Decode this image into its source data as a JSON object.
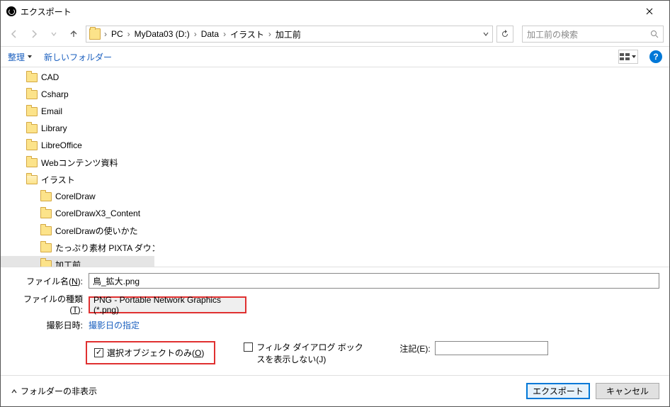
{
  "window": {
    "title": "エクスポート"
  },
  "breadcrumb": {
    "items": [
      "PC",
      "MyData03 (D:)",
      "Data",
      "イラスト",
      "加工前"
    ]
  },
  "search": {
    "placeholder": "加工前の検索"
  },
  "toolbar": {
    "organize": "整理",
    "newfolder": "新しいフォルダー"
  },
  "help": {
    "label": "?"
  },
  "tree": {
    "items": [
      {
        "label": "CAD",
        "depth": 1
      },
      {
        "label": "Csharp",
        "depth": 1
      },
      {
        "label": "Email",
        "depth": 1
      },
      {
        "label": "Library",
        "depth": 1
      },
      {
        "label": "LibreOffice",
        "depth": 1
      },
      {
        "label": "Webコンテンツ資料",
        "depth": 1
      },
      {
        "label": "イラスト",
        "depth": 1,
        "open": true
      },
      {
        "label": "CorelDraw",
        "depth": 2
      },
      {
        "label": "CorelDrawX3_Content",
        "depth": 2
      },
      {
        "label": "CorelDrawの使いかた",
        "depth": 2
      },
      {
        "label": "たっぷり素材 PIXTA ダウンロ",
        "depth": 2
      },
      {
        "label": "加工前",
        "depth": 2,
        "sel": true
      }
    ]
  },
  "fields": {
    "filename_label": "ファイル名(N):",
    "filename_value": "鳥_拡大.png",
    "filetype_label": "ファイルの種類(T):",
    "filetype_value": "PNG - Portable Network Graphics (*.png)",
    "date_label": "撮影日時:",
    "date_link": "撮影日の指定"
  },
  "options": {
    "selected_only": "選択オブジェクトのみ(O)",
    "no_filter_dialog": "フィルタ ダイアログ ボックスを表示しない(J)",
    "note_label": "注記(E):"
  },
  "footer": {
    "hide_folders": "フォルダーの非表示",
    "export": "エクスポート",
    "cancel": "キャンセル"
  }
}
